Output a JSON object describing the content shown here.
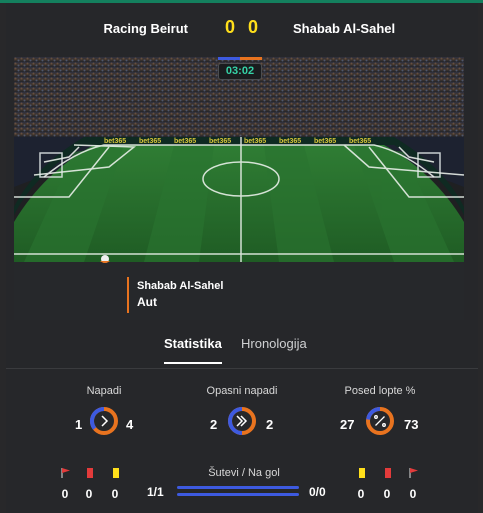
{
  "header": {
    "home_team": "Racing Beirut",
    "away_team": "Shabab Al-Sahel",
    "home_score": "0",
    "away_score": "0",
    "home_color": "#3d5ae0",
    "away_color": "#e8731f",
    "score_color": "#ffdf1b"
  },
  "pitch": {
    "clock": "03:02",
    "ad_text": "bet365",
    "event_team": "Shabab Al-Sahel",
    "event_text": "Aut"
  },
  "tabs": [
    {
      "label": "Statistika",
      "active": true
    },
    {
      "label": "Hronologija",
      "active": false
    }
  ],
  "stats": {
    "attacks": {
      "label": "Napadi",
      "home": "1",
      "away": "4",
      "icon": "chevron-right-icon",
      "home_share": 0.2
    },
    "dangerous_attacks": {
      "label": "Opasni napadi",
      "home": "2",
      "away": "2",
      "icon": "double-chevron-icon",
      "home_share": 0.5
    },
    "possession": {
      "label": "Posed lopte %",
      "home": "27",
      "away": "73",
      "icon": "percent-icon",
      "home_share": 0.27
    }
  },
  "shots": {
    "label": "Šutevi / Na gol",
    "home": "1/1",
    "away": "0/0"
  },
  "cards": {
    "home": {
      "corners": "0",
      "red": "0",
      "yellow": "0"
    },
    "away": {
      "yellow": "0",
      "red": "0",
      "corners": "0"
    }
  }
}
